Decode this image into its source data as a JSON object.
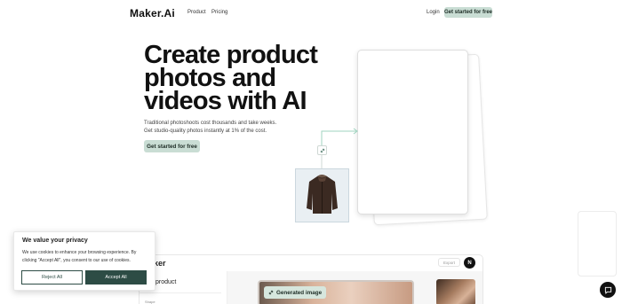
{
  "header": {
    "logo": "Maker.Ai",
    "nav": [
      "Product",
      "Pricing"
    ],
    "login": "Login",
    "cta": "Get started for free"
  },
  "hero": {
    "headline_lines": [
      "Create product",
      "photos and",
      "videos with AI"
    ],
    "subtitle_lines": [
      "Traditional photoshoots cost thousands and take weeks.",
      "Get studio-quality photos instantly at 1% of the cost."
    ],
    "cta": "Get started for free"
  },
  "preview": {
    "logo": "aker",
    "export": "Export",
    "avatar": "N",
    "sidebar_title": "product",
    "sidebar_sub": "Shape",
    "chip": "Generated image"
  },
  "cookie": {
    "title": "We value your privacy",
    "text": "We use cookies to enhance your browsing experience. By clicking \"Accept All\", you consent to our use of cookies.",
    "reject": "Reject All",
    "accept": "Accept All"
  },
  "colors": {
    "accent_green": "#c9ddd4",
    "cookie_dark": "#2d4c45"
  },
  "icons": [
    "link-icon",
    "chat-icon",
    "sparkle-icon"
  ]
}
